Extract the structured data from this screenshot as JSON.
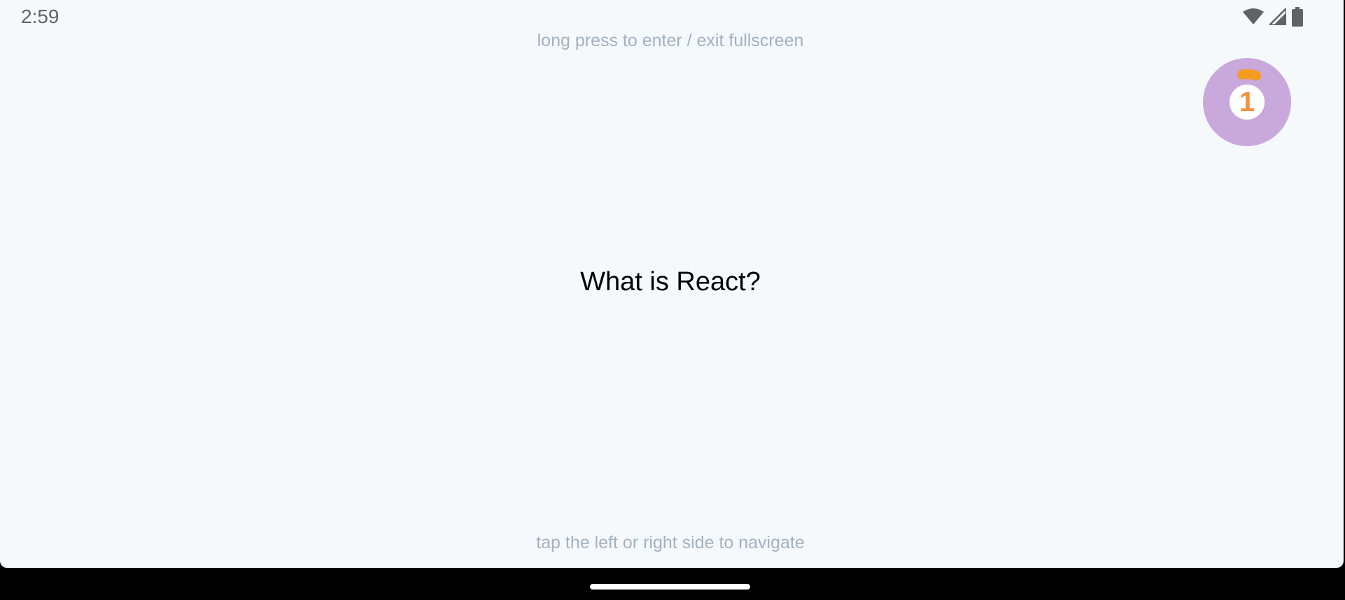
{
  "status_bar": {
    "time": "2:59",
    "icons": [
      "wifi-icon",
      "cell-signal-icon",
      "battery-icon"
    ]
  },
  "hints": {
    "top": "long press to enter / exit fullscreen",
    "bottom": "tap the left or right side to navigate"
  },
  "card": {
    "text": "What is React?"
  },
  "timer": {
    "count": "1",
    "progress_fraction": 0.08,
    "ring_color": "#c9a8dc",
    "progress_color": "#f39c1f",
    "count_color": "#f3913d"
  },
  "colors": {
    "background": "#f5f9fc",
    "hint_text": "#a3b1bf",
    "card_text": "#000000"
  }
}
